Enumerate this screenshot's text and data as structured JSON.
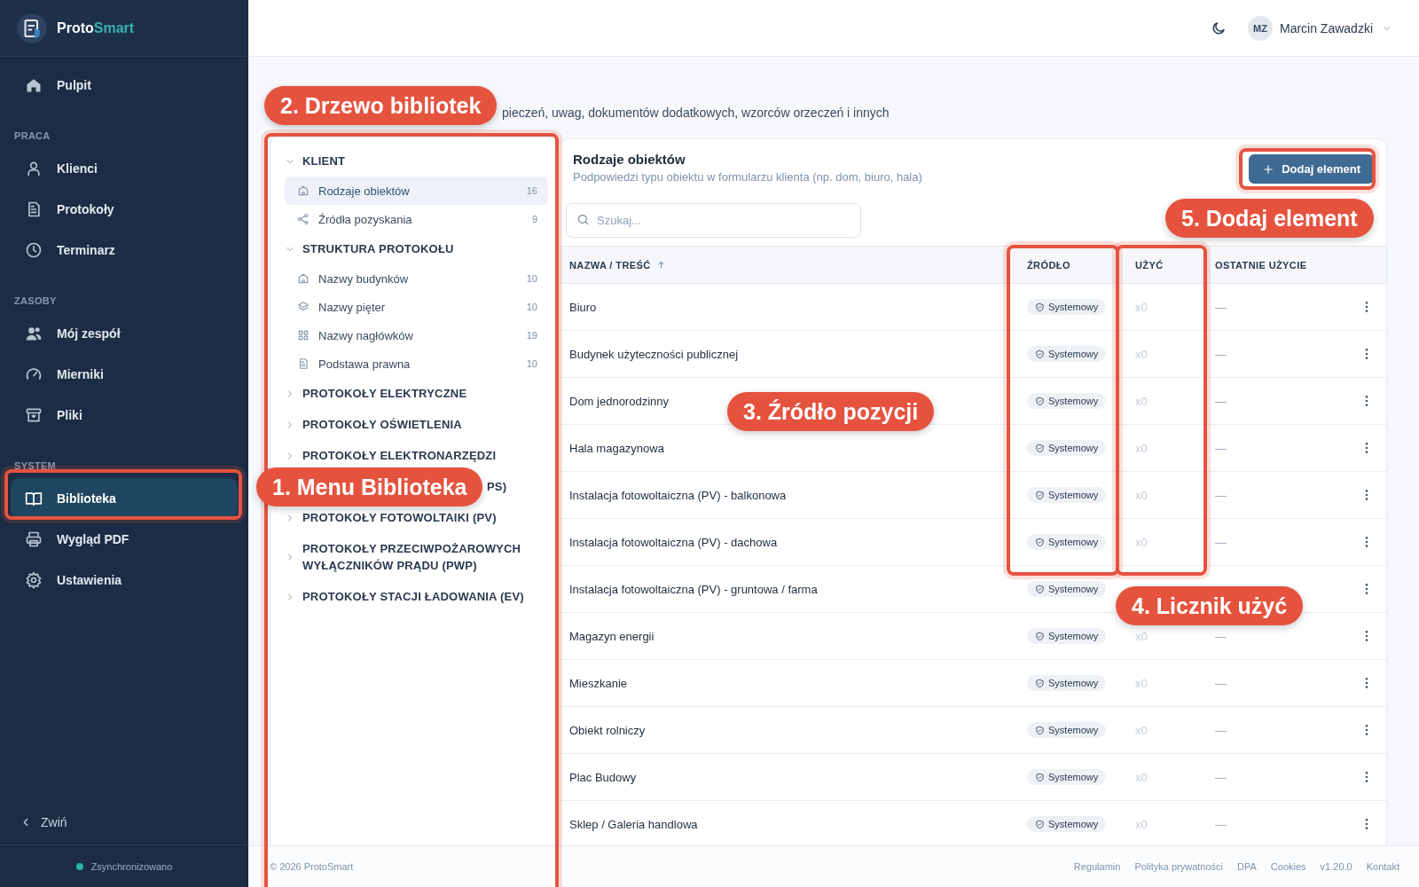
{
  "sidebar": {
    "brand": {
      "first": "Proto",
      "second": "Smart"
    },
    "nav": [
      {
        "kind": "item",
        "label": "Pulpit",
        "selected": false
      },
      {
        "kind": "heading",
        "label": "PRACA"
      },
      {
        "kind": "item",
        "label": "Klienci",
        "selected": false
      },
      {
        "kind": "item",
        "label": "Protokoły",
        "selected": false
      },
      {
        "kind": "item",
        "label": "Terminarz",
        "selected": false
      },
      {
        "kind": "heading",
        "label": "ZASOBY"
      },
      {
        "kind": "item",
        "label": "Mój zespół",
        "selected": false
      },
      {
        "kind": "item",
        "label": "Mierniki",
        "selected": false
      },
      {
        "kind": "item",
        "label": "Pliki",
        "selected": false
      },
      {
        "kind": "heading",
        "label": "SYSTEM"
      },
      {
        "kind": "item",
        "label": "Biblioteka",
        "selected": true
      },
      {
        "kind": "item",
        "label": "Wygląd PDF",
        "selected": false
      },
      {
        "kind": "item",
        "label": "Ustawienia",
        "selected": false
      }
    ],
    "collapse_label": "Zwiń",
    "sync_status": "Zsynchronizowano"
  },
  "topbar": {
    "user_initials": "MZ",
    "user_name": "Marcin Zawadzki"
  },
  "page": {
    "description": "pieczeń, uwag, dokumentów dodatkowych, wzorców orzeczeń i innych"
  },
  "tree": [
    {
      "kind": "group",
      "label": "KLIENT",
      "expanded": true,
      "children": [
        {
          "label": "Rodzaje obiektów",
          "count": "16",
          "selected": true
        },
        {
          "label": "Źródła pozyskania",
          "count": "9",
          "selected": false
        }
      ]
    },
    {
      "kind": "group",
      "label": "STRUKTURA PROTOKOŁU",
      "expanded": true,
      "children": [
        {
          "label": "Nazwy budynków",
          "count": "10",
          "selected": false
        },
        {
          "label": "Nazwy pięter",
          "count": "10",
          "selected": false
        },
        {
          "label": "Nazwy nagłówków",
          "count": "19",
          "selected": false
        },
        {
          "label": "Podstawa prawna",
          "count": "10",
          "selected": false
        }
      ]
    },
    {
      "kind": "group",
      "label": "PROTOKOŁY ELEKTRYCZNE",
      "expanded": false
    },
    {
      "kind": "group",
      "label": "PROTOKOŁY OŚWIETLENIA",
      "expanded": false
    },
    {
      "kind": "group",
      "label": "PROTOKOŁY ELEKTRONARZĘDZI",
      "expanded": false
    },
    {
      "kind": "covered",
      "label": "PS)"
    },
    {
      "kind": "group",
      "label": "PROTOKOŁY FOTOWOLTAIKI (PV)",
      "expanded": false
    },
    {
      "kind": "group",
      "label": "PROTOKOŁY PRZECIWPOŻAROWYCH WYŁĄCZNIKÓW PRĄDU (PWP)",
      "expanded": false
    },
    {
      "kind": "group",
      "label": "PROTOKOŁY STACJI ŁADOWANIA (EV)",
      "expanded": false
    }
  ],
  "card": {
    "title": "Rodzaje obiektów",
    "subtitle": "Podpowiedzi typu obiektu w formularzu klienta (np. dom, biuro, hala)",
    "add_button": "Dodaj element",
    "search_placeholder": "Szukaj...",
    "columns": [
      {
        "label": "NAZWA / TREŚĆ",
        "sorted": true
      },
      {
        "label": "ŹRÓDŁO",
        "sorted": false
      },
      {
        "label": "UŻYĆ",
        "sorted": false
      },
      {
        "label": "OSTATNIE UŻYCIE",
        "sorted": false
      }
    ],
    "rows": [
      {
        "name": "Biuro",
        "source": "Systemowy",
        "uses": "x0",
        "last_used": "—"
      },
      {
        "name": "Budynek użyteczności publicznej",
        "source": "Systemowy",
        "uses": "x0",
        "last_used": "—"
      },
      {
        "name": "Dom jednorodzinny",
        "source": "Systemowy",
        "uses": "x0",
        "last_used": "—"
      },
      {
        "name": "Hala magazynowa",
        "source": "Systemowy",
        "uses": "x0",
        "last_used": "—"
      },
      {
        "name": "Instalacja fotowoltaiczna (PV) - balkonowa",
        "source": "Systemowy",
        "uses": "x0",
        "last_used": "—"
      },
      {
        "name": "Instalacja fotowoltaiczna (PV) - dachowa",
        "source": "Systemowy",
        "uses": "x0",
        "last_used": "—"
      },
      {
        "name": "Instalacja fotowoltaiczna (PV) - gruntowa / farma",
        "source": "Systemowy"
      },
      {
        "name": "Magazyn energii",
        "source": "Systemowy",
        "uses": "x0",
        "last_used": "—"
      },
      {
        "name": "Mieszkanie",
        "source": "Systemowy",
        "uses": "x0",
        "last_used": "—"
      },
      {
        "name": "Obiekt rolniczy",
        "source": "Systemowy",
        "uses": "x0",
        "last_used": "—"
      },
      {
        "name": "Plac Budowy",
        "source": "Systemowy",
        "uses": "x0",
        "last_used": "—"
      },
      {
        "name": "Sklep / Galeria handlowa",
        "source": "Systemowy",
        "uses": "x0",
        "last_used": "—"
      }
    ]
  },
  "footer": {
    "copyright": "© 2026 ProtoSmart",
    "links": [
      "Regulamin",
      "Polityka prywatności",
      "DPA",
      "Cookies",
      "v1.20.0",
      "Kontakt"
    ]
  },
  "annotations": [
    {
      "label": "2. Drzewo bibliotek"
    },
    {
      "label": "5. Dodaj element"
    },
    {
      "label": "3. Źródło pozycji"
    },
    {
      "label": "1. Menu Biblioteka"
    },
    {
      "label": "4. Licznik użyć"
    }
  ]
}
